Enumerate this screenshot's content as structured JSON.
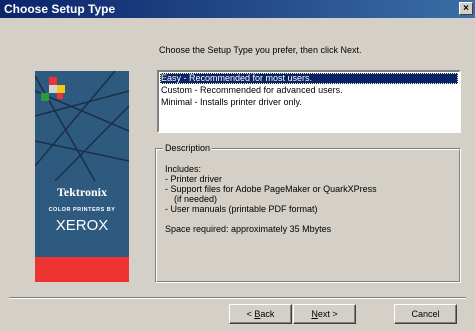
{
  "window": {
    "title": "Choose Setup Type",
    "close_label": "×"
  },
  "instruction": "Choose the Setup Type you prefer, then click Next.",
  "options": [
    {
      "label": "Easy - Recommended for most users.",
      "selected": true
    },
    {
      "label": "Custom - Recommended for advanced users.",
      "selected": false
    },
    {
      "label": "Minimal - Installs printer driver only.",
      "selected": false
    }
  ],
  "logo": {
    "brand": "Tektronix",
    "tagline": "COLOR PRINTERS BY",
    "maker": "XEROX"
  },
  "description": {
    "legend": "Description",
    "lines": [
      "Includes:",
      "- Printer driver",
      "- Support files for Adobe PageMaker or QuarkXPress",
      "  (if needed)",
      "- User manuals (printable PDF format)"
    ],
    "space": "Space required: approximately 35 Mbytes"
  },
  "buttons": {
    "back": {
      "lead": "< ",
      "hotkey": "B",
      "rest": "ack"
    },
    "next": {
      "hotkey": "N",
      "rest": "ext >"
    },
    "cancel": "Cancel"
  }
}
